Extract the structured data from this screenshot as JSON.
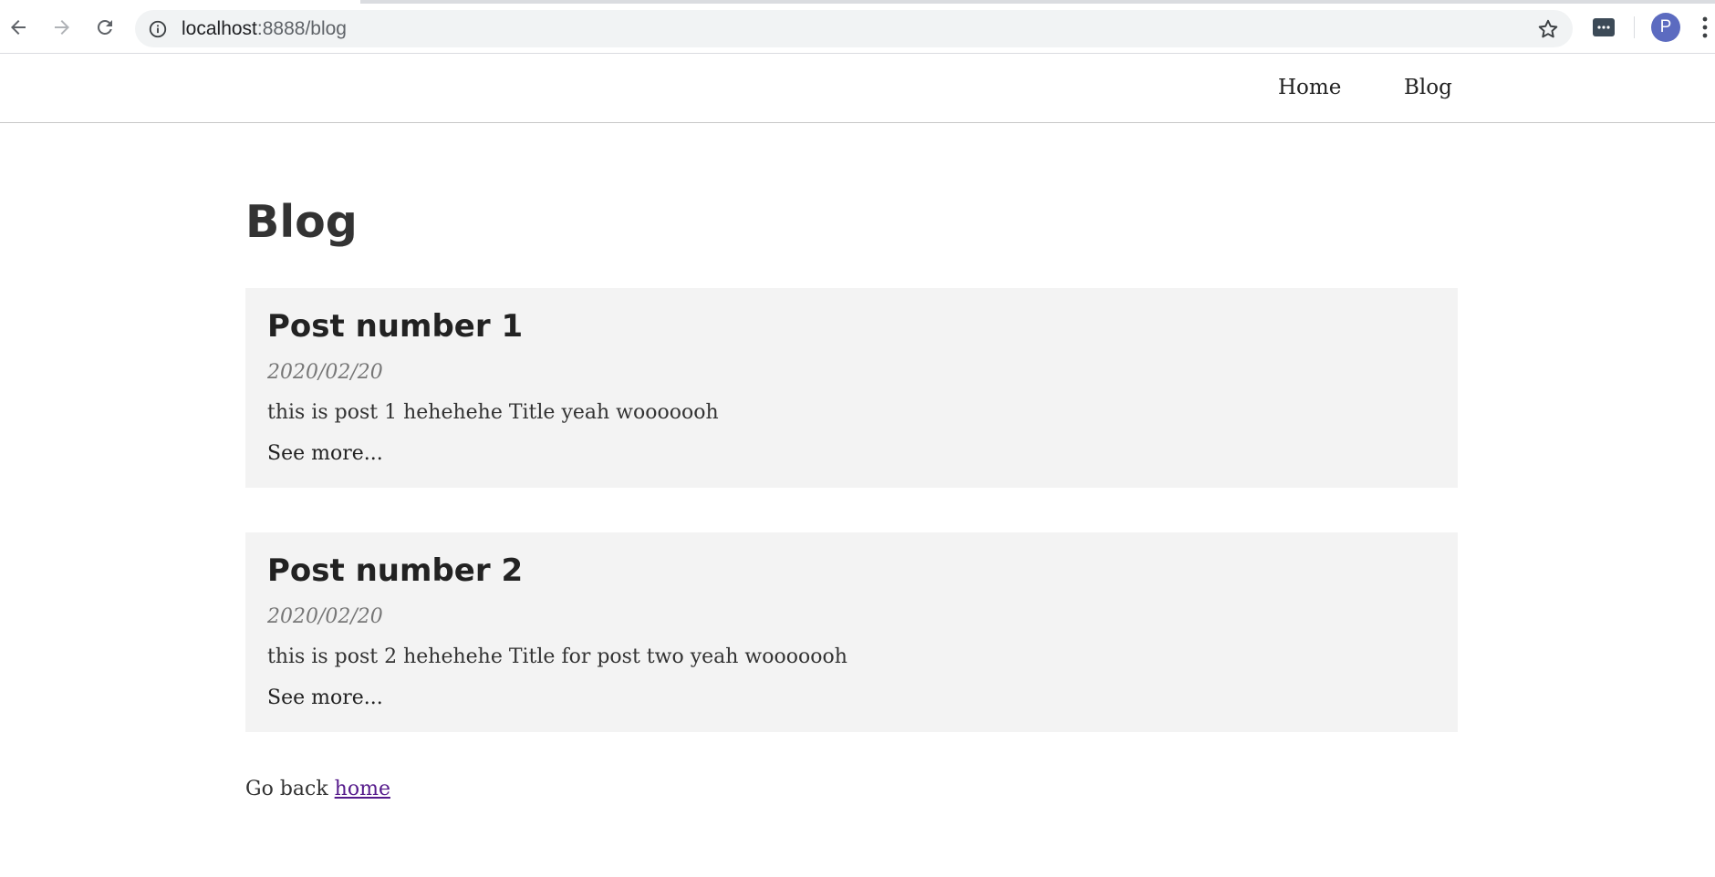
{
  "browser": {
    "url_host": "localhost",
    "url_rest": ":8888/blog",
    "profile_initial": "P",
    "icons": [
      "back-arrow-icon",
      "forward-arrow-icon",
      "reload-icon",
      "info-icon",
      "star-icon",
      "extension-icon",
      "more-vert-icon"
    ]
  },
  "nav": {
    "home": "Home",
    "blog": "Blog"
  },
  "page": {
    "title": "Blog"
  },
  "posts": [
    {
      "title": "Post number 1",
      "date": "2020/02/20",
      "excerpt": "this is post 1 hehehehe Title yeah wooooooh",
      "more": "See more..."
    },
    {
      "title": "Post number 2",
      "date": "2020/02/20",
      "excerpt": "this is post 2 hehehehe Title for post two yeah wooooooh",
      "more": "See more..."
    }
  ],
  "footer": {
    "prefix": "Go back ",
    "link": "home"
  },
  "colors": {
    "card_bg": "#f3f3f3",
    "visited_link": "#551a8b",
    "avatar": "#5c6bc0"
  }
}
